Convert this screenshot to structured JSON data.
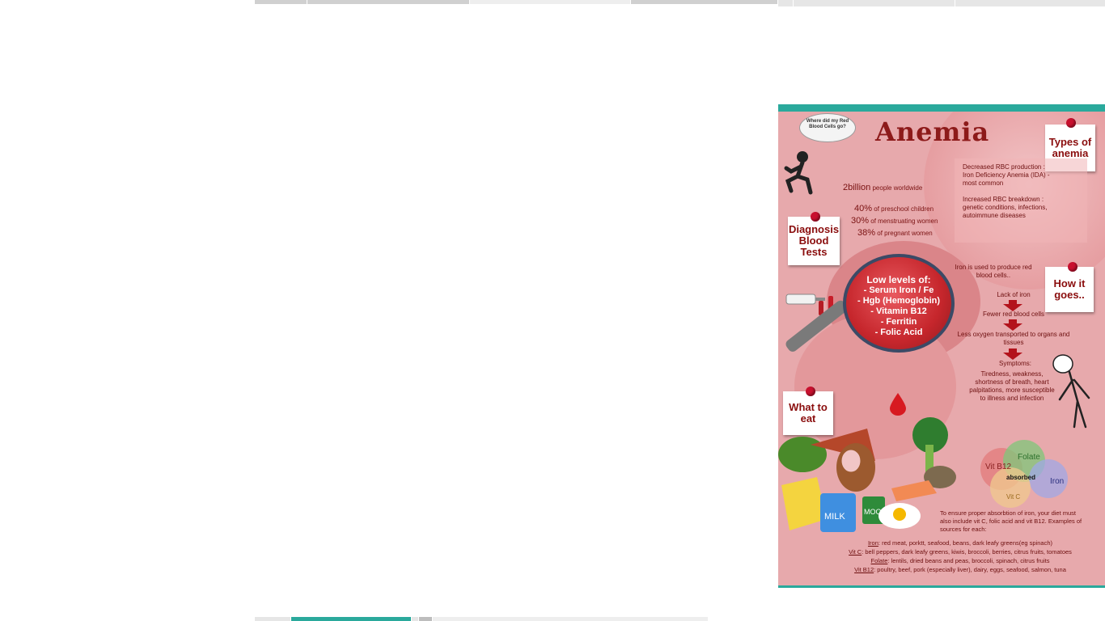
{
  "colors": {
    "accent_teal": "#2aa99c",
    "poster_bg": "#e7a9ac",
    "title_red": "#8d1a1a",
    "text_dark_red": "#6d0f0f",
    "tab_gray": "#d8d8d8",
    "tab_light": "#eeeeee"
  },
  "poster": {
    "title": "Anemia",
    "thought_bubble": "Where did my Red Blood Cells go?",
    "notes": {
      "types": "Types of anemia",
      "diagnosis": "Diagnosis Blood Tests",
      "how": "How it goes..",
      "eat": "What to eat"
    },
    "stats": {
      "headline_number": "2billion",
      "headline_text": " people worldwide",
      "s1_pct": "40%",
      "s1_text": " of preschool children",
      "s2_pct": "30%",
      "s2_text": " of menstruating women",
      "s3_pct": "38%",
      "s3_text": " of pregnant women"
    },
    "types_panel": {
      "p1_line1": "Decreased RBC production :",
      "p1_line2": "Iron Deficiency Anemia (IDA) -",
      "p1_line3": "most common",
      "p2_line1": "Increased RBC breakdown :",
      "p2_line2": "genetic conditions, infections,",
      "p2_line3": "autoimmune diseases"
    },
    "lens": {
      "heading": "Low levels of:",
      "items": [
        "- Serum Iron / Fe",
        "- Hgb (Hemoglobin)",
        "- Vitamin B12",
        "- Ferritin",
        "- Folic Acid"
      ]
    },
    "flow": {
      "intro": "Iron is used to produce red blood cells..",
      "step1": "Lack of iron",
      "step2": "Fewer red blood cells",
      "step3": "Less oxygen transported to organs and tissues",
      "step4_title": "Symptoms:",
      "step4_body": "Tiredness, weakness, shortness of breath, heart palpitations, more susceptible to illness and infection"
    },
    "venn": {
      "folate": "Folate",
      "b12": "Vit B12",
      "iron": "Iron",
      "vitc": "Vit C",
      "center": "absorbed"
    },
    "food_labels": {
      "milk": "MILK",
      "can": "MOO"
    },
    "diet_note": "To ensure proper absorbtion of iron, your diet must also include vit C, folic acid and vit B12. Examples of sources for each:",
    "sources": {
      "iron_label": "Iron",
      "iron_text": ": red meat, porktt, seafood, beans, dark leafy greens(eg spinach)",
      "vitc_label": "Vit C",
      "vitc_text": ": bell peppers, dark leafy greens, kiwis, broccoli, berries, citrus fruits, tomatoes",
      "folate_label": "Folate",
      "folate_text": ": lentils, dried beans and peas, broccoli, spinach, citrus fruits",
      "b12_label": "Vit B12",
      "b12_text": ": poultry, beef, pork (especially liver), dairy, eggs, seafood, salmon, tuna"
    }
  }
}
